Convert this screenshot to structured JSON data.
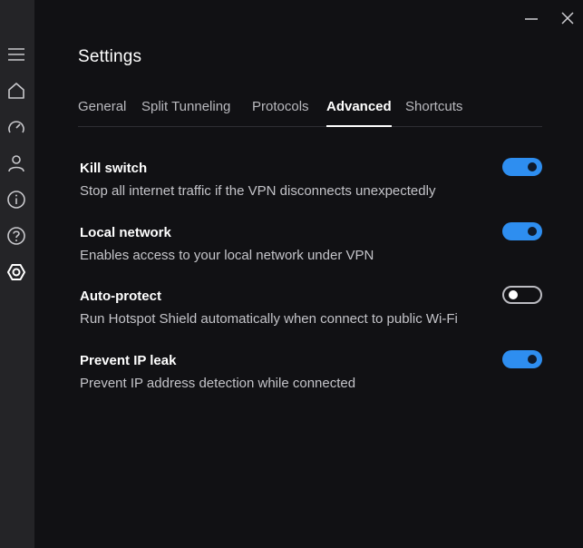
{
  "window": {
    "minimize_icon": "minimize-icon",
    "close_icon": "close-icon"
  },
  "sidebar": {
    "items": [
      {
        "icon": "menu-icon"
      },
      {
        "icon": "home-icon"
      },
      {
        "icon": "speedometer-icon"
      },
      {
        "icon": "user-icon"
      },
      {
        "icon": "info-icon"
      },
      {
        "icon": "help-icon"
      },
      {
        "icon": "settings-icon",
        "active": true
      }
    ]
  },
  "page": {
    "title": "Settings"
  },
  "tabs": [
    {
      "label": "General"
    },
    {
      "label": "Split Tunneling"
    },
    {
      "label": "Protocols"
    },
    {
      "label": "Advanced",
      "active": true
    },
    {
      "label": "Shortcuts"
    }
  ],
  "settings": [
    {
      "title": "Kill switch",
      "description": "Stop all internet traffic if the VPN disconnects unexpectedly",
      "enabled": true
    },
    {
      "title": "Local network",
      "description": "Enables access to your local network under VPN",
      "enabled": true
    },
    {
      "title": "Auto-protect",
      "description": "Run Hotspot Shield automatically when connect to public Wi-Fi",
      "enabled": false
    },
    {
      "title": "Prevent IP leak",
      "description": "Prevent IP address detection while connected",
      "enabled": true
    }
  ],
  "colors": {
    "accent": "#2e8ef0",
    "background": "#111114",
    "sidebar": "#242427"
  }
}
